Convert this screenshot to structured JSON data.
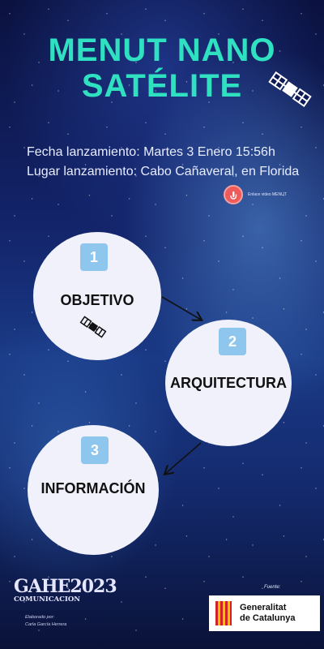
{
  "title": {
    "line1": "MENUT NANO",
    "line2": "SATÉLITE"
  },
  "launch": {
    "date_line": "Fecha lanzamiento: Martes 3 Enero  15:56h",
    "place_line": "Lugar lanzamiento: Cabo Cañaveral, en Florida"
  },
  "video_link": {
    "label": "Enlace video MENUT",
    "icon": "tap-icon"
  },
  "steps": [
    {
      "number": "1",
      "label": "OBJETIVO",
      "icon": "satellite-icon"
    },
    {
      "number": "2",
      "label": "ARQUITECTURA"
    },
    {
      "number": "3",
      "label": "INFORMACIÓN"
    }
  ],
  "footer": {
    "org_logo_main": "GAHE2023",
    "org_logo_sub": "COMUNICACION",
    "credit_line1": "Elaborado por:",
    "credit_line2": "Carla García Herrera",
    "source_label": "Fuente:",
    "gov_line1": "Generalitat",
    "gov_line2": "de Catalunya"
  },
  "colors": {
    "title": "#2fe0c1",
    "badge": "#8fc6ee",
    "circle": "#f1f1fb",
    "video_button": "#ef5a5a"
  }
}
